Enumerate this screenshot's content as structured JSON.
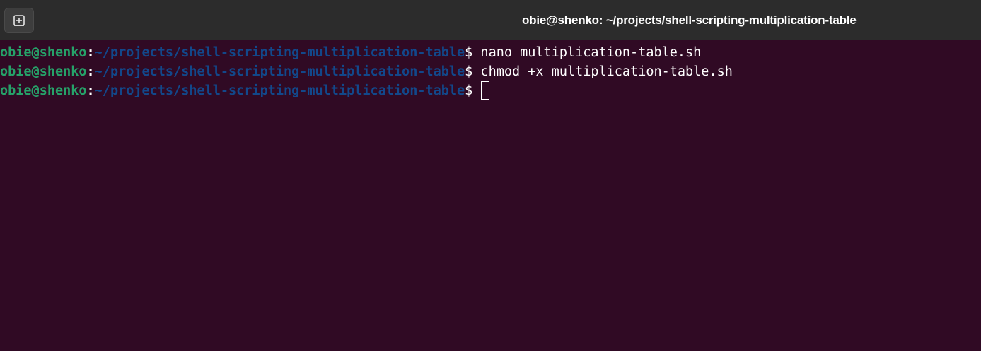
{
  "window": {
    "title": "obie@shenko: ~/projects/shell-scripting-multiplication-table"
  },
  "toolbar": {
    "new_tab_icon": "new-tab-icon"
  },
  "terminal": {
    "lines": [
      {
        "user": "obie@shenko",
        "colon": ":",
        "path": "~/projects/shell-scripting-multiplication-table",
        "dollar": "$",
        "command": " nano multiplication-table.sh"
      },
      {
        "user": "obie@shenko",
        "colon": ":",
        "path": "~/projects/shell-scripting-multiplication-table",
        "dollar": "$",
        "command": " chmod +x multiplication-table.sh"
      },
      {
        "user": "obie@shenko",
        "colon": ":",
        "path": "~/projects/shell-scripting-multiplication-table",
        "dollar": "$",
        "command": " "
      }
    ]
  },
  "colors": {
    "background": "#300a24",
    "titlebar": "#2c2c2c",
    "user": "#26a269",
    "path": "#12488b",
    "text": "#ffffff"
  }
}
